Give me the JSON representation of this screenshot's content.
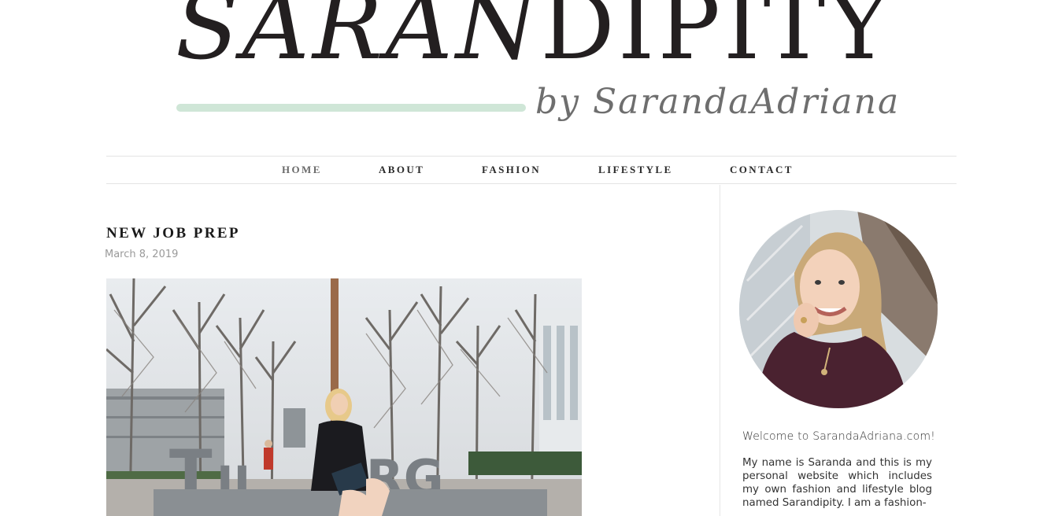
{
  "logo": {
    "part1": "SARAN",
    "part2": "DIPITY",
    "byline": "by SarandaAdriana",
    "brush_color": "#cfe6d7"
  },
  "nav": {
    "items": [
      {
        "label": "HOME"
      },
      {
        "label": "ABOUT"
      },
      {
        "label": "FASHION"
      },
      {
        "label": "LIFESTYLE"
      },
      {
        "label": "CONTACT"
      }
    ]
  },
  "post": {
    "title": "NEW JOB PREP",
    "date": "March 8, 2019",
    "image_icon": "photo-woman-tilburg-sign"
  },
  "sidebar": {
    "avatar_icon": "profile-photo",
    "welcome": "Welcome to SarandaAdriana.com!",
    "bio": "My name is Saranda and this is my personal website which includes my own fashion and lifestyle blog named Sarandipity. I am a fashion-"
  }
}
